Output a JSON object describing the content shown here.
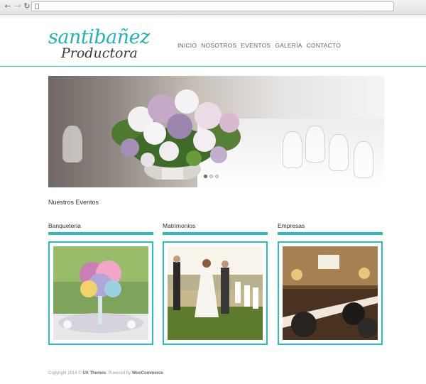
{
  "browser": {
    "back_icon": "arrow-left-icon",
    "forward_icon": "arrow-right-icon",
    "reload_icon": "reload-icon",
    "address": ""
  },
  "logo": {
    "top_text": "santibañez",
    "bottom_text": "Productora"
  },
  "menu": {
    "items": [
      "INICIO",
      "NOSOTROS",
      "EVENTOS",
      "GALERÍA",
      "CONTACTO"
    ]
  },
  "slider": {
    "slide_count": 3,
    "active_index": 0
  },
  "events": {
    "title": "Nuestros Eventos",
    "columns": [
      {
        "title": "Banqueteria"
      },
      {
        "title": "Matrimonios"
      },
      {
        "title": "Empresas"
      }
    ]
  },
  "footer": {
    "prefix": "Copyright 2014 © ",
    "brand": "UX Themes",
    "middle": ". Powered by ",
    "powered": "WooCommerce"
  },
  "colors": {
    "accent": "#2bbcbf",
    "logo_teal": "#1fb3b6"
  }
}
